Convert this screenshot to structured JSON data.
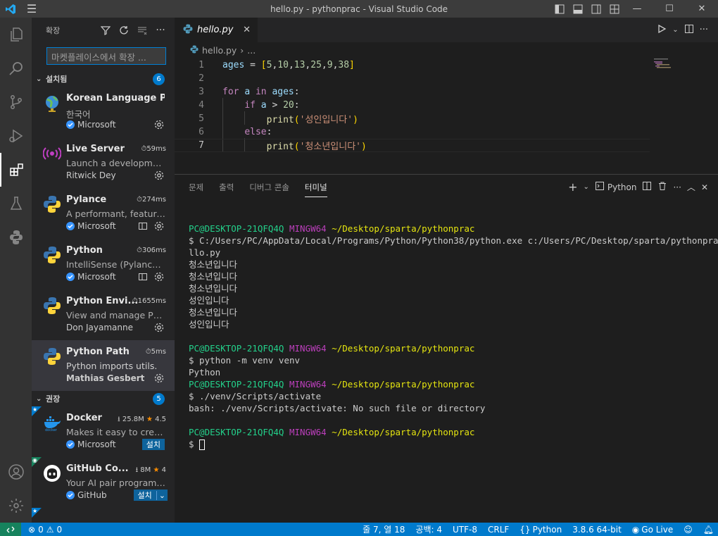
{
  "window": {
    "title": "hello.py - pythonprac - Visual Studio Code"
  },
  "sidebar": {
    "header": "확장",
    "search_placeholder": "마켓플레이스에서 확장 ...",
    "installed": {
      "label": "설치됨",
      "count": "6",
      "items": [
        {
          "name": "Korean Language Pa...",
          "desc": "한국어",
          "publisher": "Microsoft",
          "meta": ""
        },
        {
          "name": "Live Server",
          "desc": "Launch a development...",
          "publisher": "Ritwick Dey",
          "meta": "59ms"
        },
        {
          "name": "Pylance",
          "desc": "A performant, feature-...",
          "publisher": "Microsoft",
          "meta": "274ms"
        },
        {
          "name": "Python",
          "desc": "IntelliSense (Pylance), L...",
          "publisher": "Microsoft",
          "meta": "306ms"
        },
        {
          "name": "Python Envi...",
          "desc": "View and manage Pyth...",
          "publisher": "Don Jayamanne",
          "meta": "1655ms"
        },
        {
          "name": "Python Path",
          "desc": "Python imports utils.",
          "publisher": "Mathias Gesbert",
          "meta": "5ms"
        }
      ]
    },
    "recommended": {
      "label": "권장",
      "count": "5",
      "items": [
        {
          "name": "Docker",
          "desc": "Makes it easy to create...",
          "publisher": "Microsoft",
          "downloads": "25.8M",
          "rating": "4.5",
          "install_label": "설치"
        },
        {
          "name": "GitHub Co...",
          "desc": "Your AI pair programm...",
          "publisher": "GitHub",
          "downloads": "8M",
          "rating": "4",
          "install_label": "설치"
        }
      ]
    }
  },
  "editor": {
    "tab_name": "hello.py",
    "breadcrumb_file": "hello.py",
    "breadcrumb_more": "...",
    "lines": [
      "1",
      "2",
      "3",
      "4",
      "5",
      "6",
      "7"
    ]
  },
  "panel": {
    "tabs": [
      "문제",
      "출력",
      "디버그 콘솔",
      "터미널"
    ],
    "terminal_label": "Python",
    "prompt_user": "PC@DESKTOP-21QFQ4Q",
    "prompt_shell": "MINGW64",
    "prompt_path": "~/Desktop/sparta/pythonprac",
    "cmd1": "$ C:/Users/PC/AppData/Local/Programs/Python/Python38/python.exe c:/Users/PC/Desktop/sparta/pythonprac/he",
    "cmd1_wrap": "llo.py",
    "out1": [
      "청소년입니다",
      "청소년입니다",
      "청소년입니다",
      "성인입니다",
      "청소년입니다",
      "성인입니다"
    ],
    "cmd2": "$ python -m venv venv",
    "out2": "Python",
    "cmd3": "$ ./venv/Scripts/activate",
    "out3": "bash: ./venv/Scripts/activate: No such file or directory",
    "prompt_final": "$ "
  },
  "statusbar": {
    "errors": "0",
    "warnings": "0",
    "position": "줄 7, 열 18",
    "spaces": "공백: 4",
    "encoding": "UTF-8",
    "eol": "CRLF",
    "language": "Python",
    "interpreter": "3.8.6 64-bit",
    "golive": "Go Live"
  }
}
